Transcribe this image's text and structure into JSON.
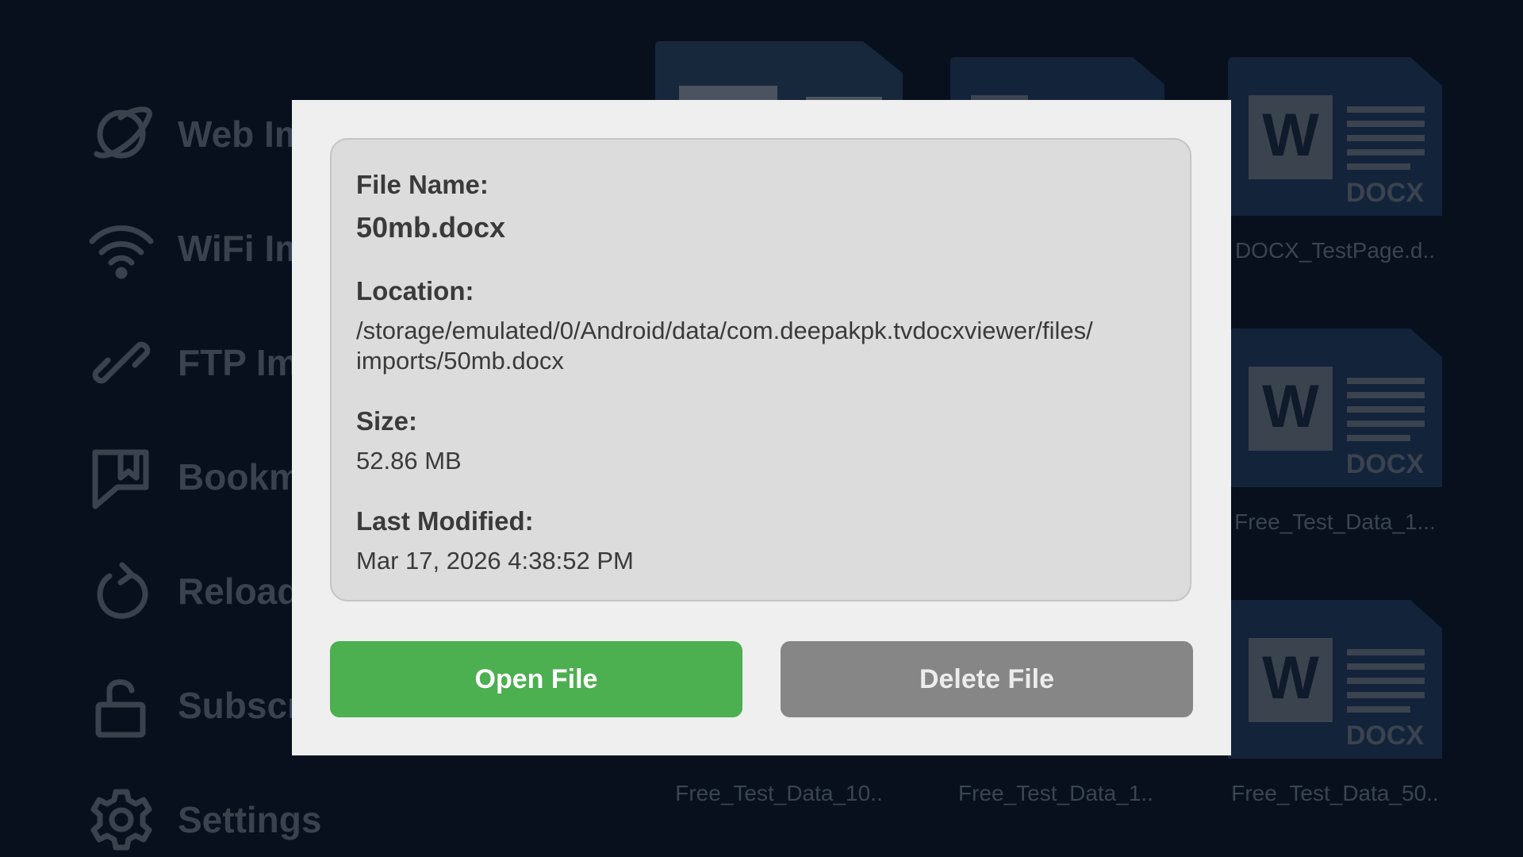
{
  "sidebar": {
    "items": [
      {
        "label": "Web Im",
        "icon": "planet-icon"
      },
      {
        "label": "WiFi Im",
        "icon": "wifi-icon"
      },
      {
        "label": "FTP Im",
        "icon": "link-icon"
      },
      {
        "label": "Bookm",
        "icon": "bookmark-icon"
      },
      {
        "label": "Reload",
        "icon": "reload-icon"
      },
      {
        "label": "Subscr",
        "icon": "lock-icon"
      },
      {
        "label": "Settings",
        "icon": "gear-icon"
      }
    ]
  },
  "files": {
    "items": [
      {
        "label": "DOCX_TestPage.d.."
      },
      {
        "label": "Free_Test_Data_1..."
      },
      {
        "label": "Free_Test_Data_10.."
      },
      {
        "label": "Free_Test_Data_1.."
      },
      {
        "label": "Free_Test_Data_50.."
      }
    ],
    "doc_type": "DOCX",
    "doc_letter": "W"
  },
  "dialog": {
    "file_name_label": "File Name:",
    "file_name": "50mb.docx",
    "location_label": "Location:",
    "location_line1": "/storage/emulated/0/Android/data/com.deepakpk.tvdocxviewer/files/",
    "location_line2": "imports/50mb.docx",
    "size_label": "Size:",
    "size": "52.86 MB",
    "modified_label": "Last Modified:",
    "modified": "Mar 17, 2026 4:38:52 PM",
    "open_button": "Open File",
    "delete_button": "Delete File"
  },
  "colors": {
    "background": "#07101c",
    "dialog": "#efefef",
    "card": "#dcdcdc",
    "open_button": "#4caf50",
    "delete_button": "#868686"
  }
}
